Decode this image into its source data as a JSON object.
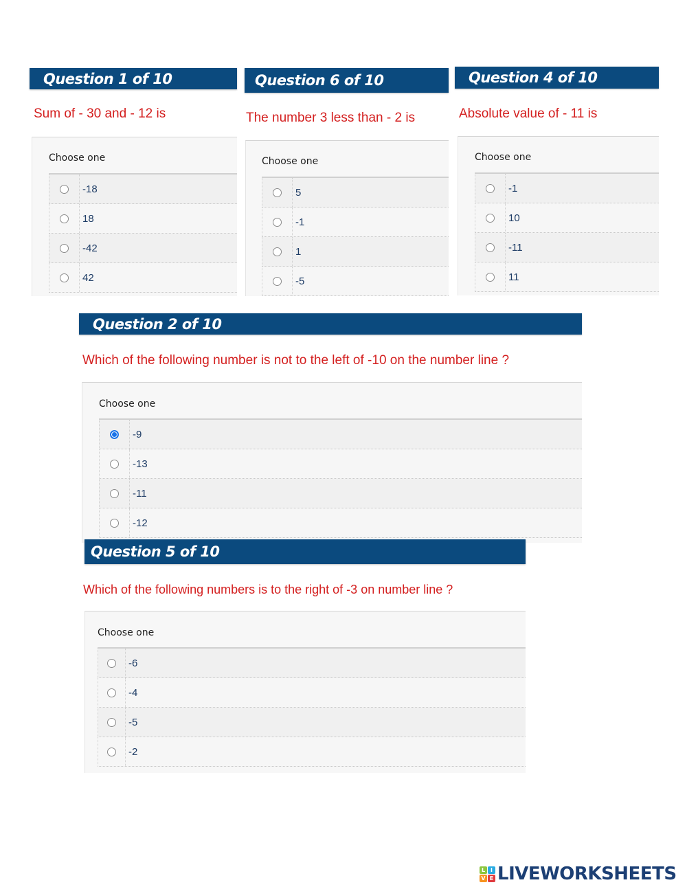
{
  "questions": [
    {
      "header": "Question 1 of 10",
      "text": "Sum of - 30 and - 12 is",
      "prompt": "Choose one",
      "options": [
        "-18",
        "18",
        "-42",
        "42"
      ],
      "selected": null
    },
    {
      "header": "Question 6 of 10",
      "text": "The number 3 less than - 2 is",
      "prompt": "Choose one",
      "options": [
        "5",
        "-1",
        "1",
        "-5"
      ],
      "selected": null
    },
    {
      "header": "Question 4 of 10",
      "text": "Absolute value of - 11 is",
      "prompt": "Choose one",
      "options": [
        "-1",
        "10",
        "-11",
        "11"
      ],
      "selected": null
    },
    {
      "header": "Question 2 of 10",
      "text": "Which of the following number is not to the left of -10 on the number line ?",
      "prompt": "Choose one",
      "options": [
        "-9",
        "-13",
        "-11",
        "-12"
      ],
      "selected": 0
    },
    {
      "header": "Question 5 of 10",
      "text": "Which of the following numbers is to the right of -3 on number line ?",
      "prompt": "Choose one",
      "options": [
        "-6",
        "-4",
        "-5",
        "-2"
      ],
      "selected": null
    }
  ],
  "footer": {
    "logo_tiles": [
      "L",
      "I",
      "V",
      "E"
    ],
    "logo_tile_colors": [
      "#8cc63f",
      "#29abe2",
      "#f7931e",
      "#e03a3e"
    ],
    "logo_text": "LIVEWORKSHEETS"
  },
  "colors": {
    "header_bg": "#0b4a7e",
    "question_text": "#d42020",
    "selected_radio": "#1a73e8"
  }
}
